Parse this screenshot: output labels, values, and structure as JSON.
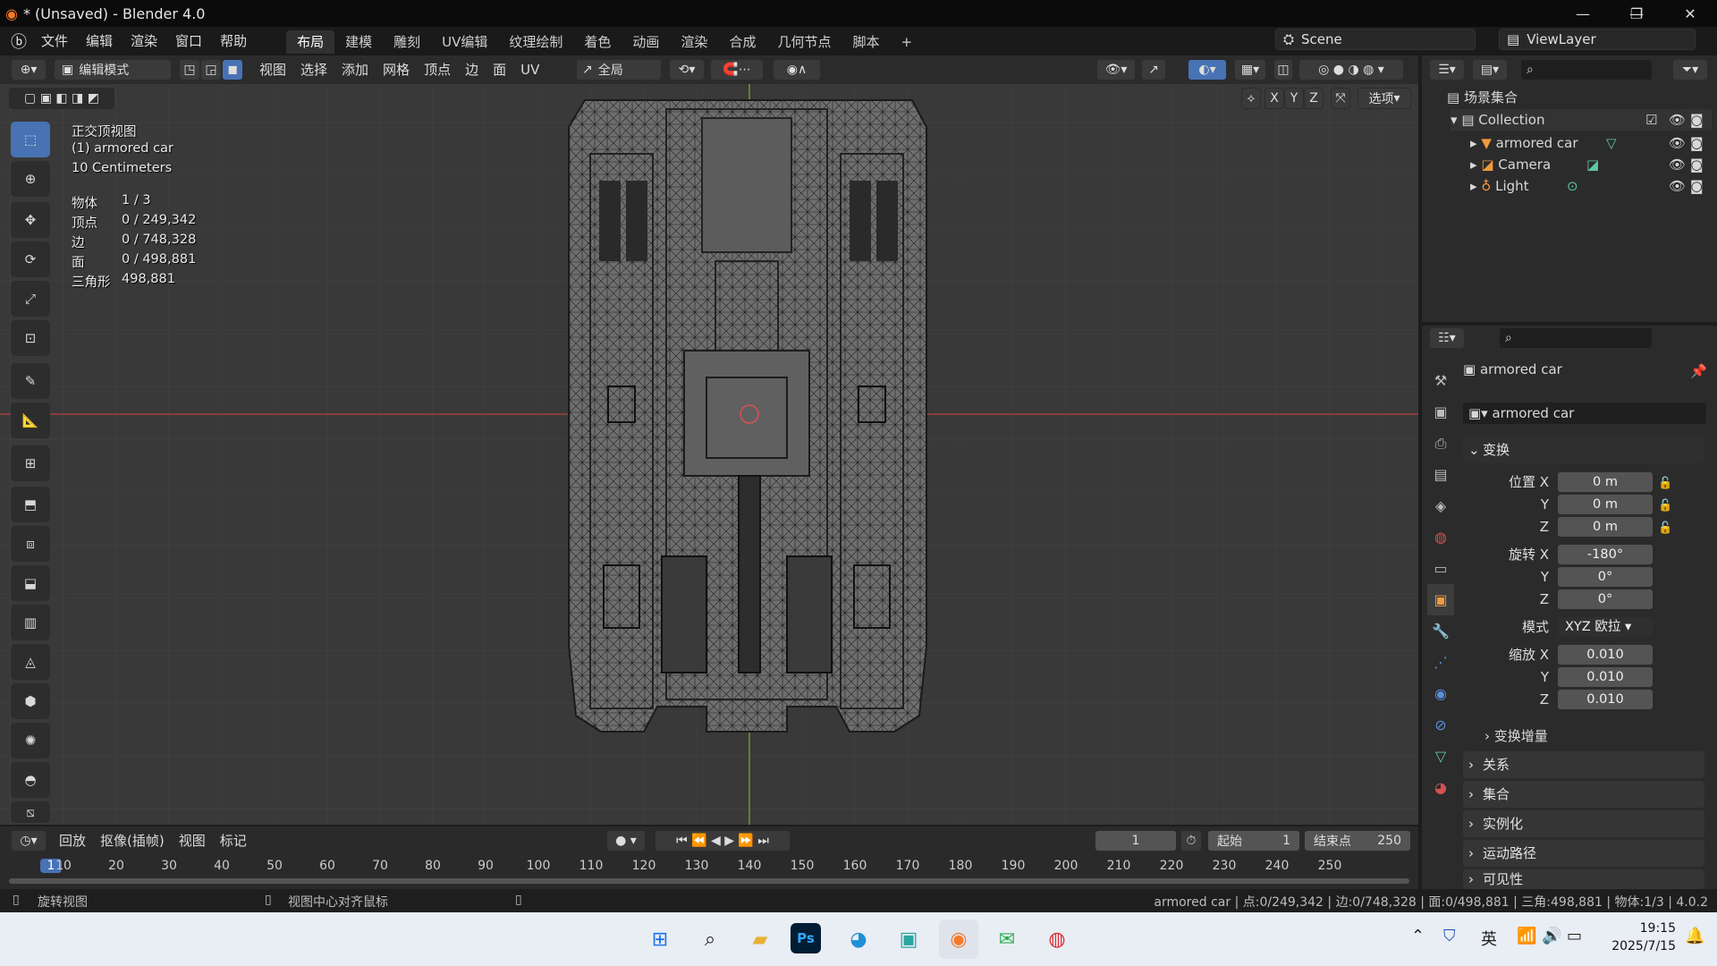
{
  "window": {
    "title": "* (Unsaved) - Blender 4.0",
    "minimize": "—",
    "maximize": "❐",
    "close": "✕"
  },
  "menu": [
    "文件",
    "编辑",
    "渲染",
    "窗口",
    "帮助"
  ],
  "workspaces": [
    "布局",
    "建模",
    "雕刻",
    "UV编辑",
    "纹理绘制",
    "着色",
    "动画",
    "渲染",
    "合成",
    "几何节点",
    "脚本",
    "+"
  ],
  "scene": {
    "label": "Scene",
    "viewlayer": "ViewLayer"
  },
  "viewport_header": {
    "mode": "编辑模式",
    "menus": [
      "视图",
      "选择",
      "添加",
      "网格",
      "顶点",
      "边",
      "面",
      "UV"
    ],
    "orientation": "全局",
    "options": "选项",
    "axes": [
      "X",
      "Y",
      "Z"
    ]
  },
  "overlay": {
    "view_name": "正交顶视图",
    "object_name": "(1) armored car",
    "scale": "10 Centimeters",
    "stats": [
      {
        "label": "物体",
        "value": "1 / 3"
      },
      {
        "label": "顶点",
        "value": "0 / 249,342"
      },
      {
        "label": "边",
        "value": "0 / 748,328"
      },
      {
        "label": "面",
        "value": "0 / 498,881"
      },
      {
        "label": "三角形",
        "value": "498,881"
      }
    ]
  },
  "outliner": {
    "root": "场景集合",
    "collection": "Collection",
    "items": [
      {
        "name": "armored car"
      },
      {
        "name": "Camera"
      },
      {
        "name": "Light"
      }
    ]
  },
  "properties": {
    "object_name": "armored car",
    "data_name": "armored car",
    "transform_header": "变换",
    "location": {
      "label": "位置 X",
      "x": "0 m",
      "y": "0 m",
      "z": "0 m"
    },
    "rotation": {
      "label": "旋转 X",
      "x": "-180°",
      "y": "0°",
      "z": "0°"
    },
    "mode": {
      "label": "模式",
      "value": "XYZ 欧拉"
    },
    "scale": {
      "label": "缩放 X",
      "x": "0.010",
      "y": "0.010",
      "z": "0.010"
    },
    "axis_y": "Y",
    "axis_z": "Z",
    "delta": "变换增量",
    "sections": [
      "关系",
      "集合",
      "实例化",
      "运动路径",
      "可见性"
    ]
  },
  "timeline": {
    "menus": [
      "回放",
      "抠像(插帧)",
      "视图",
      "标记"
    ],
    "current_frame": "1",
    "start_label": "起始",
    "start": "1",
    "end_label": "结束点",
    "end": "250",
    "ticks": [
      "1",
      "10",
      "20",
      "30",
      "40",
      "50",
      "60",
      "70",
      "80",
      "90",
      "100",
      "110",
      "120",
      "130",
      "140",
      "150",
      "160",
      "170",
      "180",
      "190",
      "200",
      "210",
      "220",
      "230",
      "240",
      "250"
    ]
  },
  "status": {
    "left1": "旋转视图",
    "left2": "视图中心对齐鼠标",
    "right": "armored car | 点:0/249,342 | 边:0/748,328 | 面:0/498,881 | 三角:498,881 | 物体:1/3 | 4.0.2"
  },
  "taskbar": {
    "lang": "英",
    "time": "19:15",
    "date": "2025/7/15"
  },
  "colors": {
    "accent": "#4772b3",
    "x_axis": "#b8413f",
    "y_axis": "#7fa83a"
  }
}
